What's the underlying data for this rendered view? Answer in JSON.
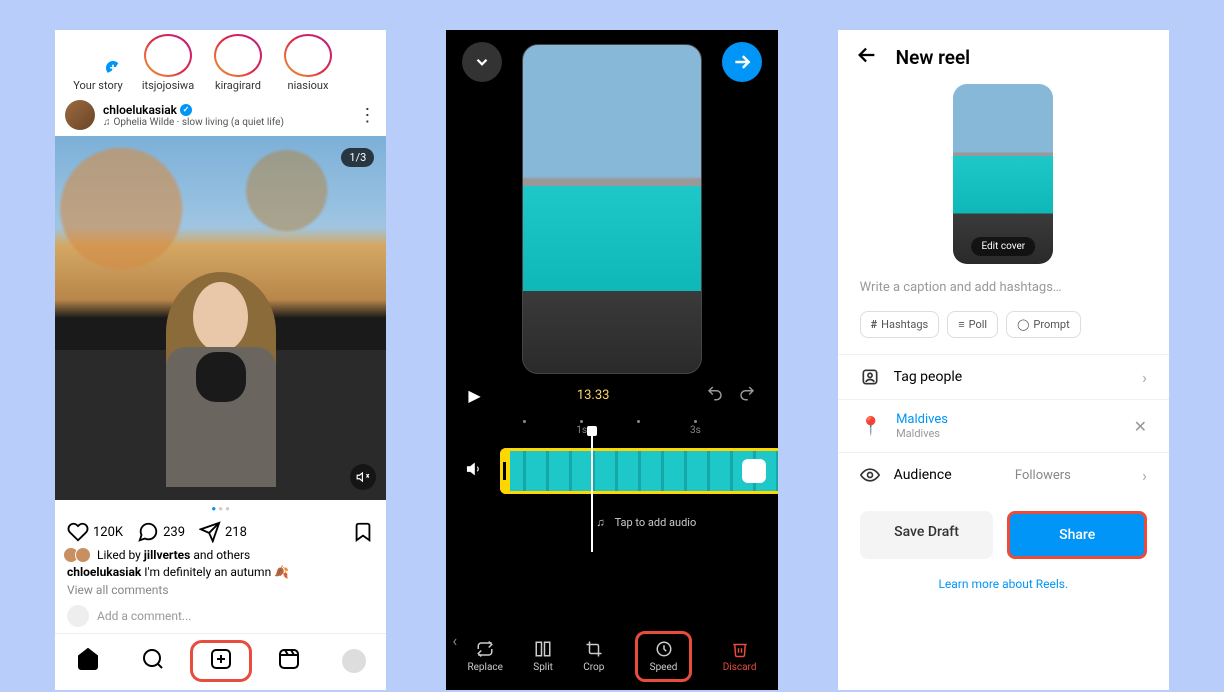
{
  "screen1": {
    "stories": [
      {
        "label": "Your story",
        "your": true
      },
      {
        "label": "itsjojosiwa"
      },
      {
        "label": "kiragirard"
      },
      {
        "label": "niasioux"
      }
    ],
    "post": {
      "username": "chloelukasiak",
      "audio_prefix": "♫",
      "audio": "Ophelia Wilde · slow living (a quiet life)",
      "counter": "1/3",
      "likes": "120K",
      "comments": "239",
      "shares": "218",
      "liked_by_prefix": "Liked by",
      "liked_by_user": "jillvertes",
      "liked_by_suffix": "and others",
      "caption_user": "chloelukasiak",
      "caption_text": "I'm definitely an autumn 🍂",
      "view_comments": "View all comments",
      "add_comment": "Add a comment..."
    }
  },
  "screen2": {
    "time": "13.33",
    "ticks": [
      "",
      "1s",
      "",
      "3s"
    ],
    "tap_audio": "Tap to add audio",
    "tabs": {
      "replace": "Replace",
      "split": "Split",
      "crop": "Crop",
      "speed": "Speed",
      "discard": "Discard"
    }
  },
  "screen3": {
    "title": "New reel",
    "edit_cover": "Edit cover",
    "caption_placeholder": "Write a caption and add hashtags…",
    "chips": {
      "hashtags": "Hashtags",
      "poll": "Poll",
      "prompt": "Prompt"
    },
    "tag_people": "Tag people",
    "location": {
      "name": "Maldives",
      "sub": "Maldives"
    },
    "audience": {
      "label": "Audience",
      "value": "Followers"
    },
    "save_draft": "Save Draft",
    "share": "Share",
    "learn": "Learn more about Reels."
  }
}
